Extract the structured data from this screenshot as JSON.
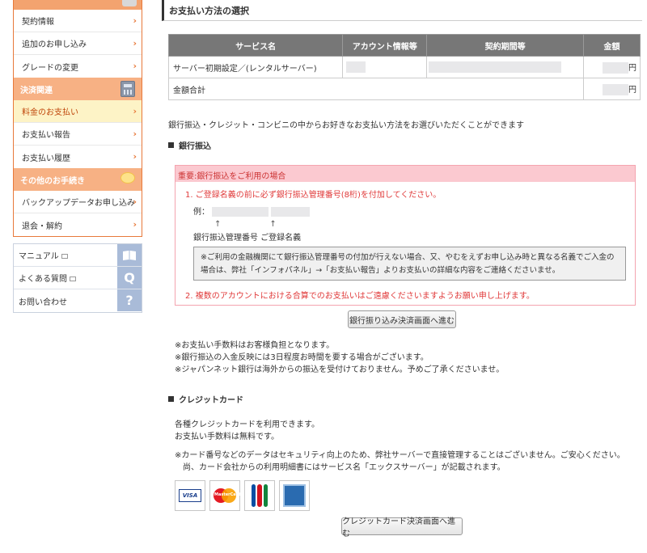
{
  "sidebar": {
    "items": [
      {
        "label": "契約情報"
      },
      {
        "label": "追加のお申し込み"
      },
      {
        "label": "グレードの変更"
      }
    ],
    "payment_section": "決済関連",
    "payment_items": [
      {
        "label": "料金のお支払い",
        "active": true
      },
      {
        "label": "お支払い報告"
      },
      {
        "label": "お支払い履歴"
      }
    ],
    "other_section": "その他のお手続き",
    "other_items": [
      {
        "label": "バックアップデータお申し込み"
      },
      {
        "label": "退会・解約"
      }
    ],
    "help_items": [
      {
        "label": "マニュアル",
        "icon": "book-icon"
      },
      {
        "label": "よくある質問",
        "icon": "q-icon",
        "glyph": "Q"
      },
      {
        "label": "お問い合わせ",
        "icon": "question-icon",
        "glyph": "?"
      }
    ]
  },
  "main": {
    "title": "お支払い方法の選択",
    "table": {
      "headers": [
        "サービス名",
        "アカウント情報等",
        "契約期間等",
        "金額"
      ],
      "rows": [
        {
          "service": "サーバー初期設定／(レンタルサーバー)",
          "yen": "円"
        },
        {
          "service": "金額合計",
          "yen": "円"
        }
      ]
    },
    "intro": "銀行振込・クレジット・コンビニの中からお好きなお支払い方法をお選びいただくことができます",
    "bank": {
      "heading": "銀行振込",
      "notice_head": "重要:銀行振込をご利用の場合",
      "line1": "1. ご登録名義の前に必ず銀行振込管理番号(8桁)を付加してください。",
      "example_label": "例：",
      "arrows": "↑　　　　　　↑",
      "labels": "銀行振込管理番号 ご登録名義",
      "graybox": "※ご利用の金融機関にて銀行振込管理番号の付加が行えない場合、又、やむをえずお申し込み時と異なる名義でご入金の場合は、弊社「インフォパネル」→「お支払い報告」よりお支払いの詳細な内容をご連絡くださいませ。",
      "line2": "2. 複数のアカウントにおける合算でのお支払いはご遠慮くださいますようお願い申し上げます。",
      "button": "銀行振り込み決済画面へ進む",
      "notes": [
        "※お支払い手数料はお客様負担となります。",
        "※銀行振込の入金反映には3日程度お時間を要する場合がございます。",
        "※ジャパンネット銀行は海外からの振込を受付けておりません。予めご了承くださいませ。"
      ]
    },
    "credit": {
      "heading": "クレジットカード",
      "desc": [
        "各種クレジットカードを利用できます。",
        "お支払い手数料は無料です。"
      ],
      "notes": [
        "※カード番号などのデータはセキュリティ向上のため、弊社サーバーで直接管理することはございません。ご安心ください。",
        "　尚、カード会社からの利用明細書にはサービス名「エックスサーバー」が記載されます。"
      ],
      "cards": [
        "VISA",
        "MasterCard",
        "JCB",
        "AMERICAN EXPRESS"
      ],
      "button": "クレジットカード決済画面へ進む"
    }
  }
}
